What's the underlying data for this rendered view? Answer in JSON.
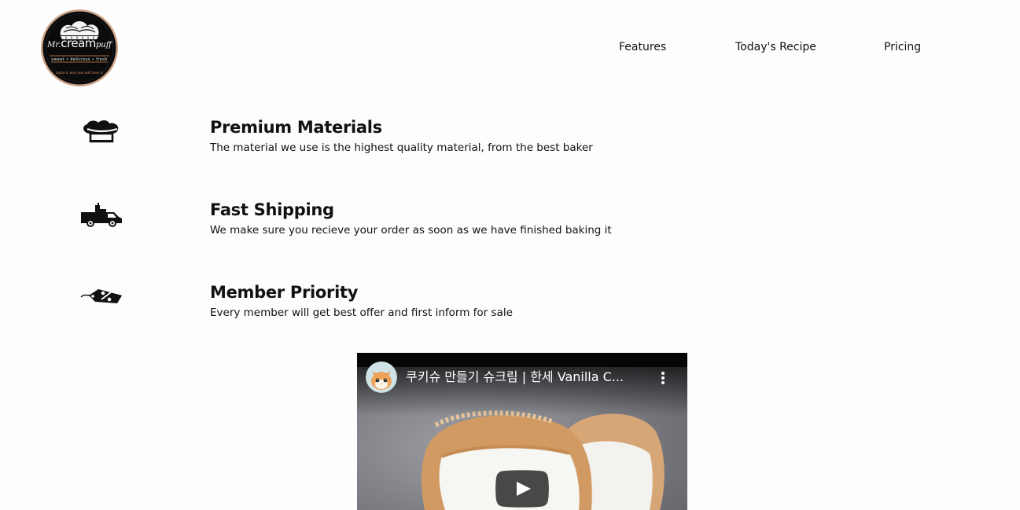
{
  "brand": {
    "logo_line1": "Mr.",
    "logo_line1_big": "cream",
    "logo_line1_end": "puff",
    "logo_sub": "sweet • delicious • fresh",
    "logo_motto": "taste it and you will love it"
  },
  "nav": {
    "items": [
      {
        "label": "Features"
      },
      {
        "label": "Today's Recipe"
      },
      {
        "label": "Pricing"
      }
    ]
  },
  "features": [
    {
      "icon": "chef-hat-icon",
      "title": "Premium Materials",
      "description": "The material we use is the highest quality material, from the best baker"
    },
    {
      "icon": "delivery-truck-icon",
      "title": "Fast Shipping",
      "description": "We make sure you recieve your order as soon as we have finished baking it"
    },
    {
      "icon": "discount-tag-icon",
      "title": "Member Priority",
      "description": "Every member will get best offer and first inform for sale"
    }
  ],
  "video": {
    "title": "쿠키슈 만들기 슈크림 | 한세 Vanilla C...",
    "channel_avatar": "cat-avatar-icon",
    "menu_icon": "more-vert-icon",
    "play_icon": "play-button-icon"
  },
  "colors": {
    "background": "#fdfdfd",
    "text": "#111111",
    "logo_ring": "#c9a184",
    "play_button": "#212121"
  }
}
